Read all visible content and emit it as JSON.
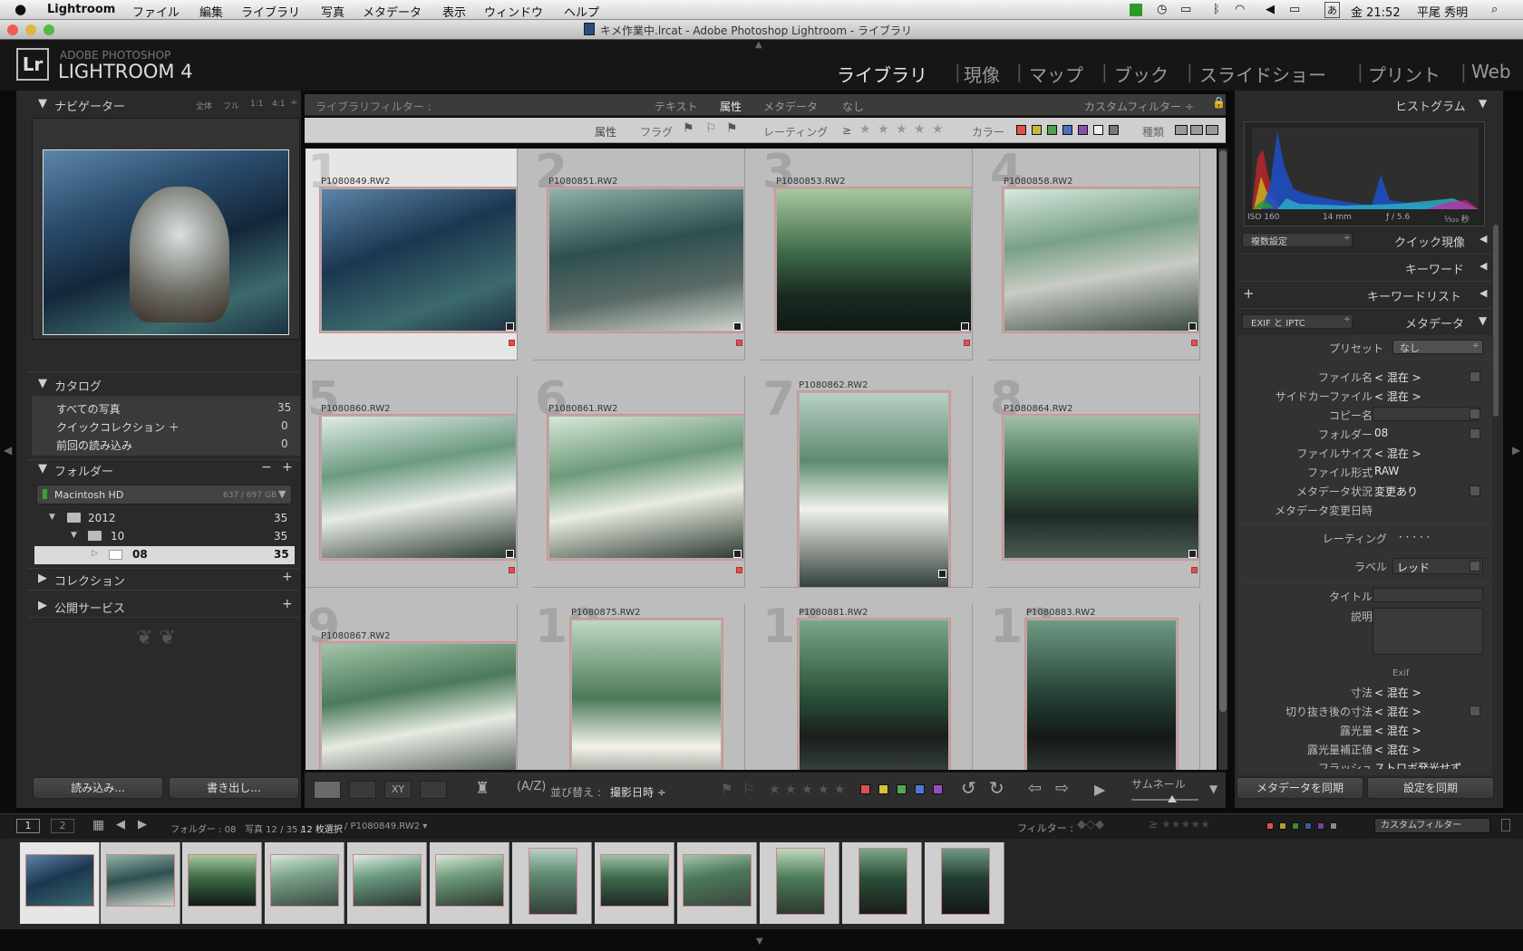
{
  "menubar": {
    "items": [
      "Lightroom",
      "ファイル",
      "編集",
      "ライブラリ",
      "写真",
      "メタデータ",
      "表示",
      "ウィンドウ",
      "ヘルプ"
    ],
    "clock": "金 21:52",
    "user": "平尾 秀明"
  },
  "window": {
    "title": "キメ作業中.lrcat - Adobe Photoshop Lightroom - ライブラリ"
  },
  "branding": {
    "line1": "ADOBE PHOTOSHOP",
    "line2": "LIGHTROOM 4",
    "logo": "Lr"
  },
  "modules": [
    "ライブラリ",
    "現像",
    "マップ",
    "ブック",
    "スライドショー",
    "プリント",
    "Web"
  ],
  "navigator": {
    "title": "ナビゲーター",
    "zoom": [
      "全体",
      "フル",
      "1:1",
      "4:1"
    ]
  },
  "catalog": {
    "title": "カタログ",
    "items": [
      {
        "label": "すべての写真",
        "count": "35"
      },
      {
        "label": "クイックコレクション ＋",
        "count": "0"
      },
      {
        "label": "前回の読み込み",
        "count": "0"
      }
    ]
  },
  "folders": {
    "title": "フォルダー",
    "volume": "Macintosh HD",
    "volume_info": "637 / 697 GB",
    "items": [
      {
        "label": "2012",
        "count": "35"
      },
      {
        "label": "10",
        "count": "35"
      },
      {
        "label": "08",
        "count": "35"
      }
    ]
  },
  "collections": {
    "title": "コレクション"
  },
  "publish": {
    "title": "公開サービス"
  },
  "left_buttons": {
    "import": "読み込み...",
    "export": "書き出し..."
  },
  "filter": {
    "title": "ライブラリフィルター :",
    "tabs": [
      "テキスト",
      "属性",
      "メタデータ",
      "なし"
    ],
    "custom": "カスタムフィルター ÷",
    "attr": "属性",
    "flag": "フラグ",
    "rating": "レーティング",
    "rating_op": "≥",
    "color": "カラー",
    "kind": "種類"
  },
  "grid": {
    "cells": [
      {
        "num": "1",
        "name": "P1080849.RW2"
      },
      {
        "num": "2",
        "name": "P1080851.RW2"
      },
      {
        "num": "3",
        "name": "P1080853.RW2"
      },
      {
        "num": "4",
        "name": "P1080858.RW2"
      },
      {
        "num": "5",
        "name": "P1080860.RW2"
      },
      {
        "num": "6",
        "name": "P1080861.RW2"
      },
      {
        "num": "7",
        "name": "P1080862.RW2"
      },
      {
        "num": "8",
        "name": "P1080864.RW2"
      },
      {
        "num": "9",
        "name": "P1080867.RW2"
      },
      {
        "num": "10",
        "name": "P1080875.RW2"
      },
      {
        "num": "11",
        "name": "P1080881.RW2"
      },
      {
        "num": "12",
        "name": "P1080883.RW2"
      }
    ]
  },
  "toolbar": {
    "sort_label": "並び替え :",
    "sort_value": "撮影日時 ÷",
    "thumb_label": "サムネール"
  },
  "histogram": {
    "title": "ヒストグラム",
    "iso": "ISO 160",
    "focal": "14 mm",
    "aperture": "ƒ / 5.6",
    "shutter": "¹⁄₃₂₀ 秒"
  },
  "quick_develop": {
    "title": "クイック現像",
    "preset": "複数設定"
  },
  "keywording": {
    "title": "キーワード"
  },
  "keyword_list": {
    "title": "キーワードリスト"
  },
  "metadata": {
    "title": "メタデータ",
    "view": "EXIF と IPTC",
    "preset_label": "プリセット",
    "preset_value": "なし",
    "rows": [
      {
        "label": "ファイル名",
        "value": "< 混在 >"
      },
      {
        "label": "サイドカーファイル",
        "value": "< 混在 >"
      },
      {
        "label": "コピー名",
        "value": ""
      },
      {
        "label": "フォルダー",
        "value": "08"
      },
      {
        "label": "ファイルサイズ",
        "value": "< 混在 >"
      },
      {
        "label": "ファイル形式",
        "value": "RAW"
      },
      {
        "label": "メタデータ状況",
        "value": "変更あり"
      },
      {
        "label": "メタデータ変更日時",
        "value": ""
      }
    ],
    "rating_label": "レーティング",
    "rating_value": "· · · · ·",
    "label_label": "ラベル",
    "label_value": "レッド",
    "title_label": "タイトル",
    "caption_label": "説明",
    "exif_header": "Exif",
    "exif_rows": [
      {
        "label": "寸法",
        "value": "< 混在 >"
      },
      {
        "label": "切り抜き後の寸法",
        "value": "< 混在 >"
      },
      {
        "label": "露光量",
        "value": "< 混在 >"
      },
      {
        "label": "露光量補正値",
        "value": "< 混在 >"
      },
      {
        "label": "フラッシュ",
        "value": "ストロボ発光せず"
      }
    ]
  },
  "right_buttons": {
    "sync_meta": "メタデータを同期",
    "sync_settings": "設定を同期"
  },
  "filmstrip_bar": {
    "page1": "1",
    "page2": "2",
    "source_prefix": "フォルダー : 08",
    "source_detail": "写真 12 / 35 /",
    "source_selected": "12 枚選択",
    "source_file": "/ P1080849.RW2 ▾",
    "filter_label": "フィルター :",
    "custom": "カスタムフィルター"
  },
  "colors": {
    "label_red": "#e05050",
    "panel": "#2c2c2c",
    "grid": "#bdbdbd",
    "selected_cell": "#e6e6e6"
  }
}
